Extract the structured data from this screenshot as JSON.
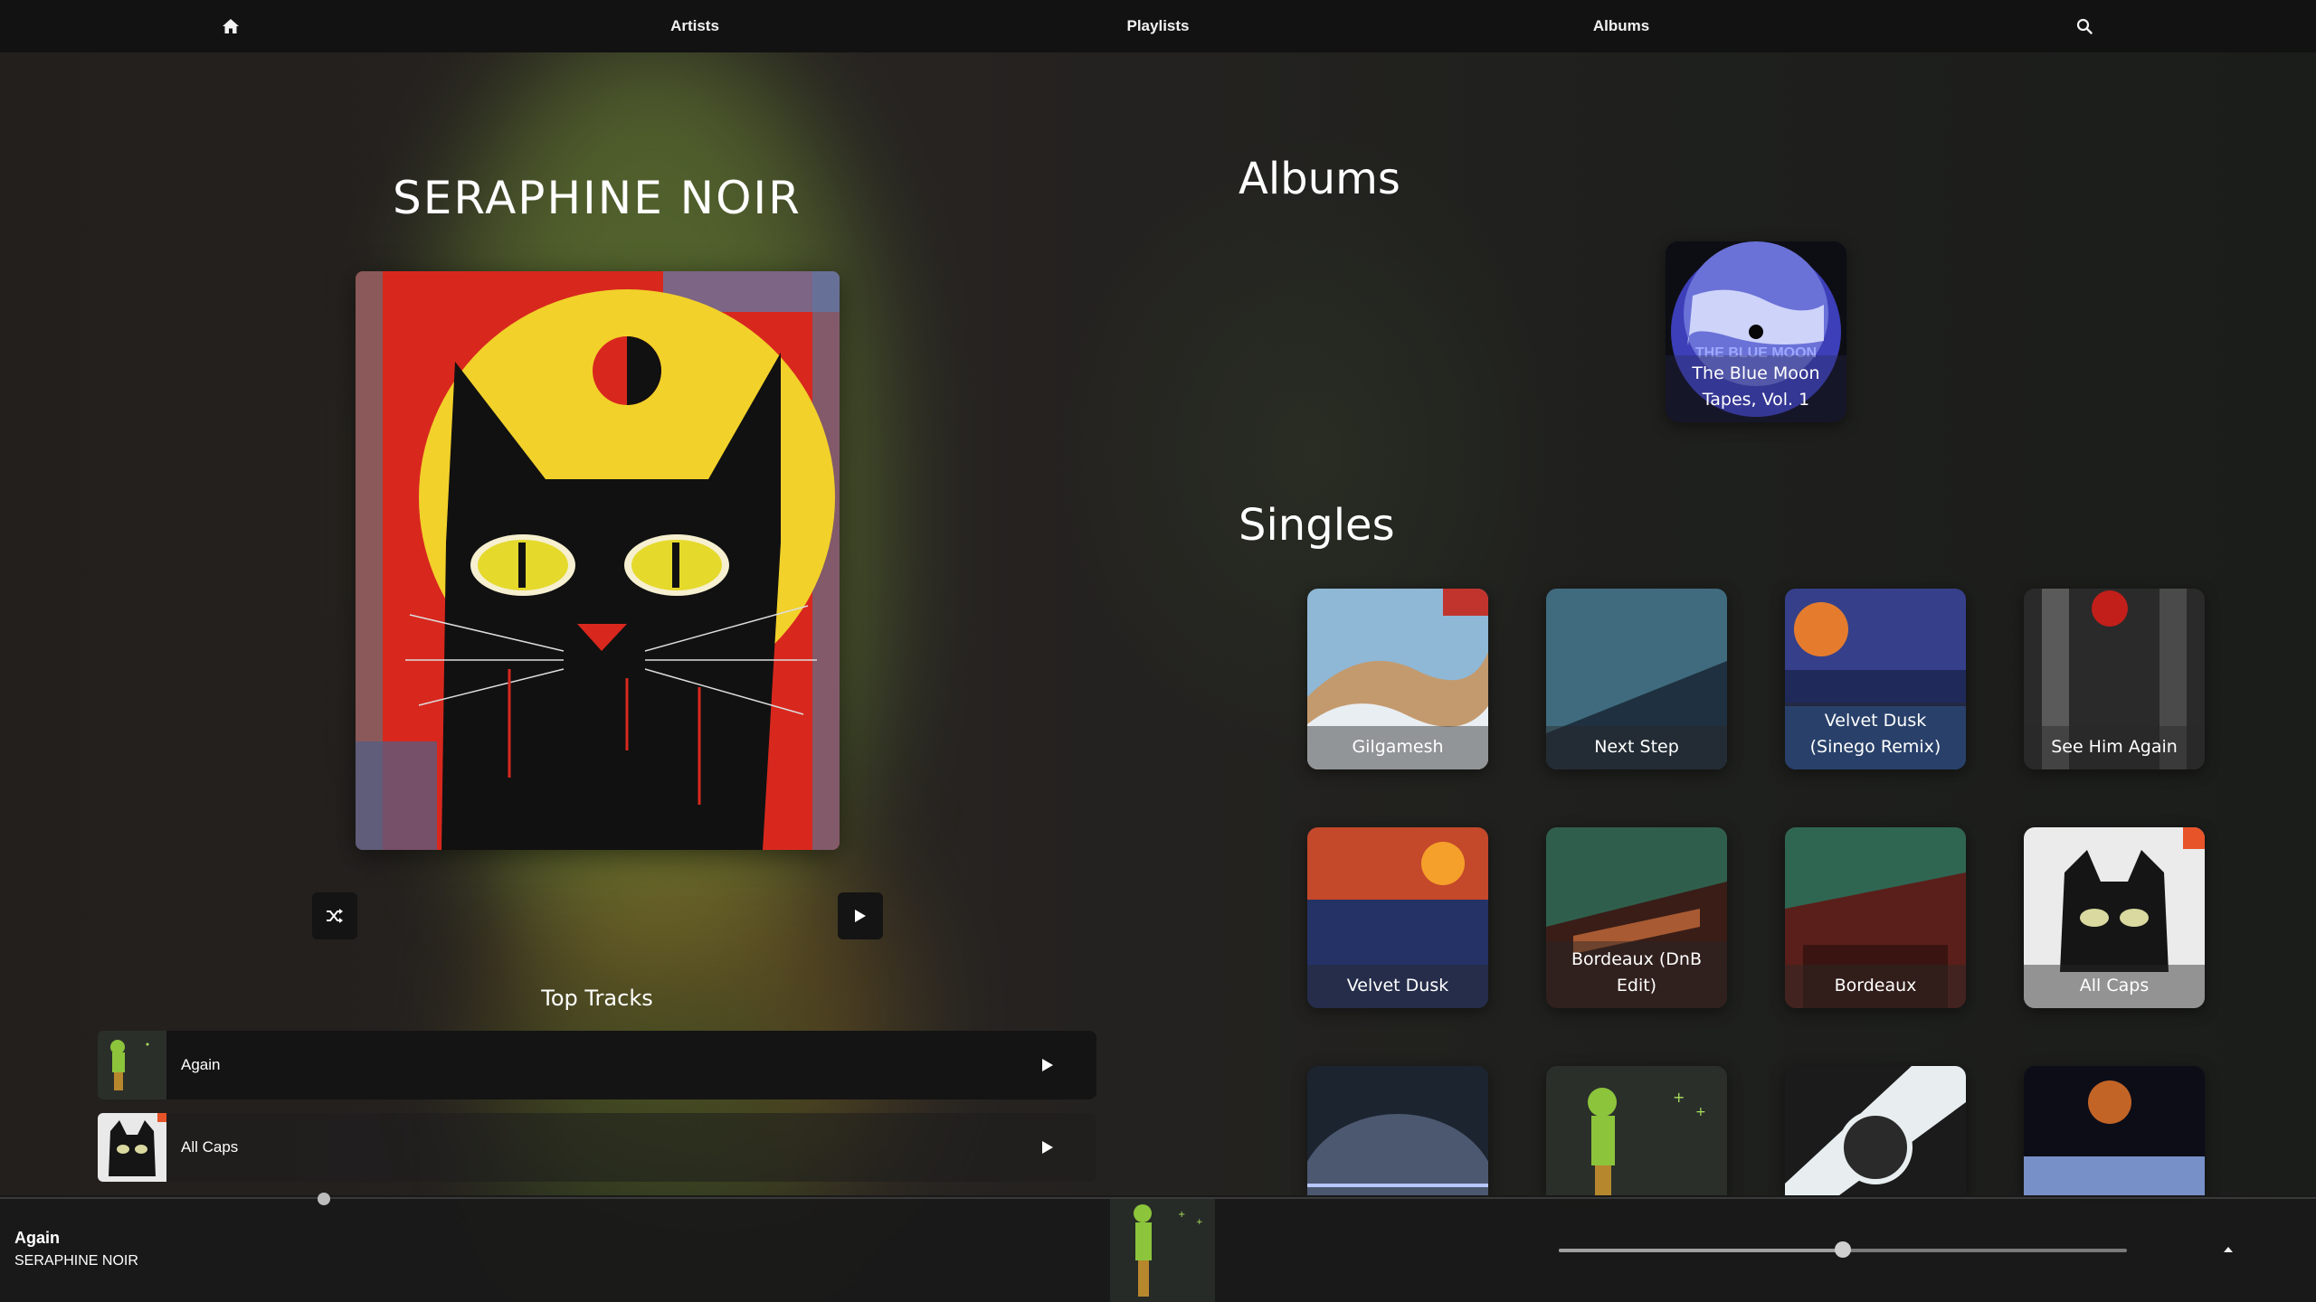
{
  "nav": {
    "home_icon": "home-icon",
    "artists": "Artists",
    "playlists": "Playlists",
    "albums": "Albums",
    "search_icon": "search-icon"
  },
  "artist": {
    "name": "SERAPHINE NOIR",
    "shuffle_icon": "shuffle-icon",
    "play_icon": "play-icon"
  },
  "top_tracks": {
    "label": "Top Tracks",
    "items": [
      {
        "title": "Again"
      },
      {
        "title": "All Caps"
      }
    ]
  },
  "albums": {
    "heading": "Albums",
    "items": [
      {
        "title": "The Blue Moon Tapes, Vol. 1",
        "art_text": "THE BLUE MOON"
      }
    ]
  },
  "singles": {
    "heading": "Singles",
    "items": [
      {
        "title": "Gilgamesh"
      },
      {
        "title": "Next Step"
      },
      {
        "title": "Velvet Dusk (Sinego Remix)"
      },
      {
        "title": "See Him Again"
      },
      {
        "title": "Velvet Dusk"
      },
      {
        "title": "Bordeaux (DnB Edit)"
      },
      {
        "title": "Bordeaux"
      },
      {
        "title": "All Caps"
      },
      {
        "title": ""
      },
      {
        "title": ""
      },
      {
        "title": ""
      },
      {
        "title": ""
      }
    ]
  },
  "player": {
    "title": "Again",
    "artist": "SERAPHINE NOIR",
    "progress_fraction": 0.14,
    "volume_fraction": 0.5,
    "expand_icon": "chevron-up-icon"
  },
  "colors": {
    "nav_bg": "#121212",
    "accent_red": "#d8281e",
    "accent_yellow": "#f2d12a"
  }
}
